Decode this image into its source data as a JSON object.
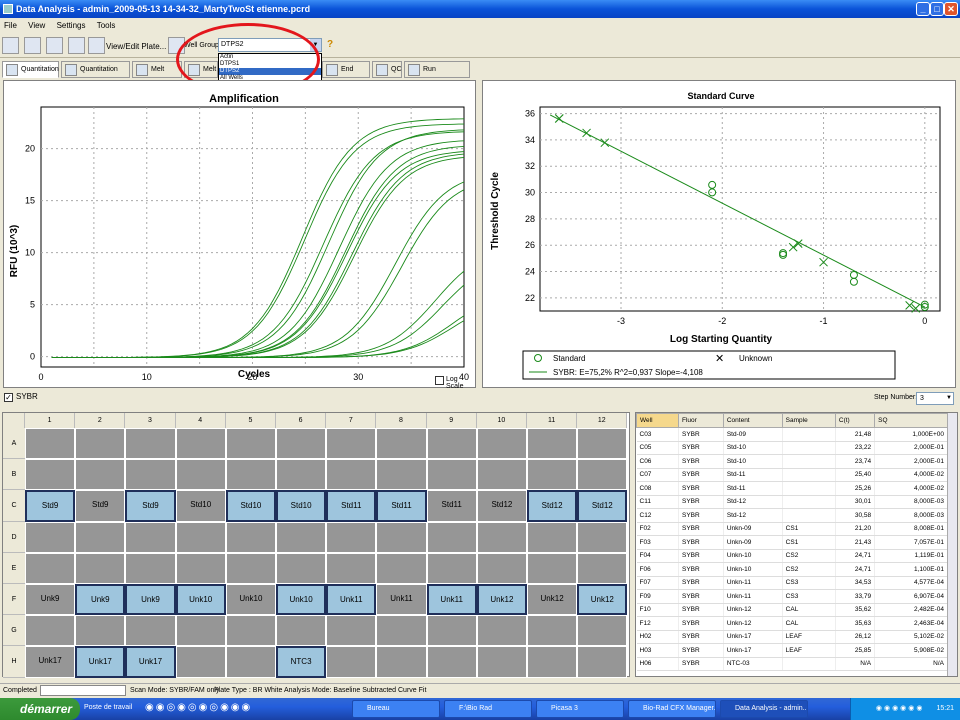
{
  "window": {
    "title": "Data Analysis - admin_2009-05-13 14-34-32_MartyTwoSt etienne.pcrd"
  },
  "menu": [
    "File",
    "View",
    "Settings",
    "Tools"
  ],
  "toolbar": {
    "view_edit_plate": "View/Edit Plate...",
    "well_group_label": "Well Group:",
    "well_group_value": "DTPS2",
    "help": "?"
  },
  "well_group_options": [
    "Actin",
    "DTPS1",
    "DTPS2",
    "All Wells"
  ],
  "tabs": [
    "Quantitation",
    "Quantitation Data",
    "Melt Curve",
    "Melt",
    "End Point",
    "QC",
    "Run Information"
  ],
  "amplification": {
    "title": "Amplification",
    "xlabel": "Cycles",
    "ylabel": "RFU (10^3)",
    "log_scale": "Log Scale",
    "xticks": [
      "0",
      "10",
      "20",
      "30",
      "40"
    ],
    "yticks": [
      "0",
      "5",
      "10",
      "15",
      "20"
    ]
  },
  "chart_data": [
    {
      "type": "line",
      "title": "Amplification",
      "xlabel": "Cycles",
      "ylabel": "RFU (10^3)",
      "xlim": [
        0,
        40
      ],
      "ylim": [
        -1,
        24
      ],
      "curves": [
        {
          "ct": 21.2,
          "plateau": 23.0
        },
        {
          "ct": 21.4,
          "plateau": 22.5
        },
        {
          "ct": 23.2,
          "plateau": 21.8
        },
        {
          "ct": 23.7,
          "plateau": 22.0
        },
        {
          "ct": 24.7,
          "plateau": 21.0
        },
        {
          "ct": 25.3,
          "plateau": 20.5
        },
        {
          "ct": 25.4,
          "plateau": 20.0
        },
        {
          "ct": 25.9,
          "plateau": 19.8
        },
        {
          "ct": 26.1,
          "plateau": 19.5
        },
        {
          "ct": 30.0,
          "plateau": 18.0
        },
        {
          "ct": 30.6,
          "plateau": 17.5
        },
        {
          "ct": 33.8,
          "plateau": 11.0
        },
        {
          "ct": 34.5,
          "plateau": 10.0
        },
        {
          "ct": 35.6,
          "plateau": 6.8
        },
        {
          "ct": 35.6,
          "plateau": 6.0
        }
      ]
    },
    {
      "type": "scatter",
      "title": "Standard Curve",
      "xlabel": "Log Starting Quantity",
      "ylabel": "Threshold Cycle",
      "xlim": [
        -3.8,
        0.15
      ],
      "ylim": [
        21,
        36.5
      ],
      "xticks": [
        "-3",
        "-2",
        "-1",
        "0"
      ],
      "yticks": [
        "22",
        "24",
        "26",
        "28",
        "30",
        "32",
        "34",
        "36"
      ],
      "standard": [
        [
          0,
          21.48
        ],
        [
          0,
          21.3
        ],
        [
          -0.7,
          23.22
        ],
        [
          -0.7,
          23.74
        ],
        [
          -1.4,
          25.4
        ],
        [
          -1.4,
          25.26
        ],
        [
          -2.1,
          30.01
        ],
        [
          -2.1,
          30.58
        ]
      ],
      "unknown": [
        [
          -0.09,
          21.2
        ],
        [
          -0.15,
          21.43
        ],
        [
          -1.0,
          24.71
        ],
        [
          -1.25,
          26.12
        ],
        [
          -1.3,
          25.85
        ],
        [
          -3.34,
          34.53
        ],
        [
          -3.16,
          33.79
        ],
        [
          -3.61,
          35.62
        ],
        [
          -3.61,
          35.63
        ]
      ],
      "fit": {
        "x": [
          -3.7,
          0
        ],
        "y": [
          35.9,
          21.3
        ]
      },
      "legend": {
        "standard": "Standard",
        "unknown": "Unknown",
        "fit": "SYBR: E=75,2% R^2=0,937 Slope=-4,108"
      }
    }
  ],
  "sybr_label": "SYBR",
  "step": {
    "label": "Step Number:",
    "value": "3"
  },
  "plate": {
    "cols": [
      "1",
      "2",
      "3",
      "4",
      "5",
      "6",
      "7",
      "8",
      "9",
      "10",
      "11",
      "12"
    ],
    "rows": [
      "A",
      "B",
      "C",
      "D",
      "E",
      "F",
      "G",
      "H"
    ],
    "wells": [
      {
        "row": 2,
        "col": 0,
        "label": "Std9",
        "hl": true
      },
      {
        "row": 2,
        "col": 1,
        "label": "Std9",
        "hl": false
      },
      {
        "row": 2,
        "col": 2,
        "label": "Std9",
        "hl": true
      },
      {
        "row": 2,
        "col": 3,
        "label": "Std10",
        "hl": false
      },
      {
        "row": 2,
        "col": 4,
        "label": "Std10",
        "hl": true
      },
      {
        "row": 2,
        "col": 5,
        "label": "Std10",
        "hl": true
      },
      {
        "row": 2,
        "col": 6,
        "label": "Std11",
        "hl": true
      },
      {
        "row": 2,
        "col": 7,
        "label": "Std11",
        "hl": true
      },
      {
        "row": 2,
        "col": 8,
        "label": "Std11",
        "hl": false
      },
      {
        "row": 2,
        "col": 9,
        "label": "Std12",
        "hl": false
      },
      {
        "row": 2,
        "col": 10,
        "label": "Std12",
        "hl": true
      },
      {
        "row": 2,
        "col": 11,
        "label": "Std12",
        "hl": true
      },
      {
        "row": 5,
        "col": 0,
        "label": "Unk9",
        "hl": false
      },
      {
        "row": 5,
        "col": 1,
        "label": "Unk9",
        "hl": true
      },
      {
        "row": 5,
        "col": 2,
        "label": "Unk9",
        "hl": true
      },
      {
        "row": 5,
        "col": 3,
        "label": "Unk10",
        "hl": true
      },
      {
        "row": 5,
        "col": 4,
        "label": "Unk10",
        "hl": false
      },
      {
        "row": 5,
        "col": 5,
        "label": "Unk10",
        "hl": true
      },
      {
        "row": 5,
        "col": 6,
        "label": "Unk11",
        "hl": true
      },
      {
        "row": 5,
        "col": 7,
        "label": "Unk11",
        "hl": false
      },
      {
        "row": 5,
        "col": 8,
        "label": "Unk11",
        "hl": true
      },
      {
        "row": 5,
        "col": 9,
        "label": "Unk12",
        "hl": true
      },
      {
        "row": 5,
        "col": 10,
        "label": "Unk12",
        "hl": false
      },
      {
        "row": 5,
        "col": 11,
        "label": "Unk12",
        "hl": true
      },
      {
        "row": 7,
        "col": 0,
        "label": "Unk17",
        "hl": false
      },
      {
        "row": 7,
        "col": 1,
        "label": "Unk17",
        "hl": true
      },
      {
        "row": 7,
        "col": 2,
        "label": "Unk17",
        "hl": true
      },
      {
        "row": 7,
        "col": 5,
        "label": "NTC3",
        "hl": true
      }
    ]
  },
  "table": {
    "headers": [
      "Well",
      "Fluor",
      "Content",
      "Sample",
      "C(t)",
      "SQ"
    ],
    "rows": [
      [
        "C03",
        "SYBR",
        "Std-09",
        "",
        "21,48",
        "1,000E+00"
      ],
      [
        "C05",
        "SYBR",
        "Std-10",
        "",
        "23,22",
        "2,000E-01"
      ],
      [
        "C06",
        "SYBR",
        "Std-10",
        "",
        "23,74",
        "2,000E-01"
      ],
      [
        "C07",
        "SYBR",
        "Std-11",
        "",
        "25,40",
        "4,000E-02"
      ],
      [
        "C08",
        "SYBR",
        "Std-11",
        "",
        "25,26",
        "4,000E-02"
      ],
      [
        "C11",
        "SYBR",
        "Std-12",
        "",
        "30,01",
        "8,000E-03"
      ],
      [
        "C12",
        "SYBR",
        "Std-12",
        "",
        "30,58",
        "8,000E-03"
      ],
      [
        "F02",
        "SYBR",
        "Unkn-09",
        "CS1",
        "21,20",
        "8,008E-01"
      ],
      [
        "F03",
        "SYBR",
        "Unkn-09",
        "CS1",
        "21,43",
        "7,057E-01"
      ],
      [
        "F04",
        "SYBR",
        "Unkn-10",
        "CS2",
        "24,71",
        "1,119E-01"
      ],
      [
        "F06",
        "SYBR",
        "Unkn-10",
        "CS2",
        "24,71",
        "1,100E-01"
      ],
      [
        "F07",
        "SYBR",
        "Unkn-11",
        "CS3",
        "34,53",
        "4,577E-04"
      ],
      [
        "F09",
        "SYBR",
        "Unkn-11",
        "CS3",
        "33,79",
        "6,907E-04"
      ],
      [
        "F10",
        "SYBR",
        "Unkn-12",
        "CAL",
        "35,62",
        "2,482E-04"
      ],
      [
        "F12",
        "SYBR",
        "Unkn-12",
        "CAL",
        "35,63",
        "2,463E-04"
      ],
      [
        "H02",
        "SYBR",
        "Unkn-17",
        "LEAF",
        "26,12",
        "5,102E-02"
      ],
      [
        "H03",
        "SYBR",
        "Unkn-17",
        "LEAF",
        "25,85",
        "5,908E-02"
      ],
      [
        "H06",
        "SYBR",
        "NTC-03",
        "",
        "N/A",
        "N/A"
      ]
    ]
  },
  "status": {
    "completed": "Completed",
    "scan_mode": "Scan Mode: SYBR/FAM only",
    "plate_type": "Plate Type : BR White",
    "analysis_mode": "Analysis Mode: Baseline Subtracted Curve Fit"
  },
  "taskbar": {
    "start": "démarrer",
    "poste": "Poste de travail",
    "items": [
      "Bureau",
      "F:\\Bio Rad",
      "Picasa 3",
      "Bio-Rad CFX Manager...",
      "Data Analysis - admin..."
    ],
    "clock": "15:21"
  },
  "colors": {
    "curve": "#1a8a1a",
    "highlight": "#9ec5dd",
    "well_gray": "#969696",
    "annotation": "#e3161c"
  }
}
